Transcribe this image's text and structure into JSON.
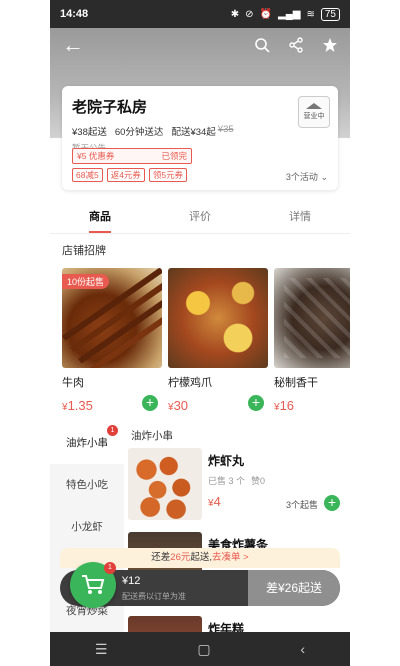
{
  "status_bar": {
    "time": "14:48",
    "icons": [
      "bluetooth-icon",
      "mute-icon",
      "alarm-icon",
      "signal-icon",
      "wifi-icon"
    ],
    "battery": "75"
  },
  "shop": {
    "name": "老院子私房",
    "min_order": "¥38起送",
    "delivery_time": "60分钟送达",
    "delivery_fee": "配送¥34起",
    "original_fee": "¥35",
    "notice": "暂无公告",
    "logo_text": "营业中",
    "coupon": {
      "label": "¥5 优惠券",
      "status": "已领完"
    },
    "promos": [
      "68减5",
      "返4元券",
      "领5元券"
    ],
    "activity": "3个活动"
  },
  "tabs": [
    {
      "label": "商品",
      "active": true
    },
    {
      "label": "评价",
      "active": false
    },
    {
      "label": "详情",
      "active": false
    }
  ],
  "featured": {
    "title": "店铺招牌",
    "items": [
      {
        "name": "牛肉",
        "price": "1.35",
        "badge": "10份起售"
      },
      {
        "name": "柠檬鸡爪",
        "price": "30"
      },
      {
        "name": "秘制香干",
        "price": "16"
      }
    ]
  },
  "categories": [
    {
      "label": "油炸小串",
      "badge": "1",
      "active": true
    },
    {
      "label": "特色小吃"
    },
    {
      "label": "小龙虾"
    },
    {
      "label": ""
    },
    {
      "label": "夜宵炒菜"
    }
  ],
  "menu": {
    "section": "油炸小串",
    "dishes": [
      {
        "name": "炸虾丸",
        "sold": "已售 3 个",
        "likes": "赞0",
        "price": "4",
        "min": "3个起售"
      },
      {
        "name": "美食炸薯条"
      },
      {
        "name": "炸年糕"
      }
    ]
  },
  "cart": {
    "tip_prefix": "还差",
    "tip_amount": "26元",
    "tip_mid": "起送,",
    "tip_link": "去凑单 >",
    "total": "¥12",
    "note": "配送费以订单为准",
    "badge": "1",
    "checkout": "差¥26起送"
  },
  "colors": {
    "accent": "#e85a4f",
    "green": "#3bb55a"
  }
}
